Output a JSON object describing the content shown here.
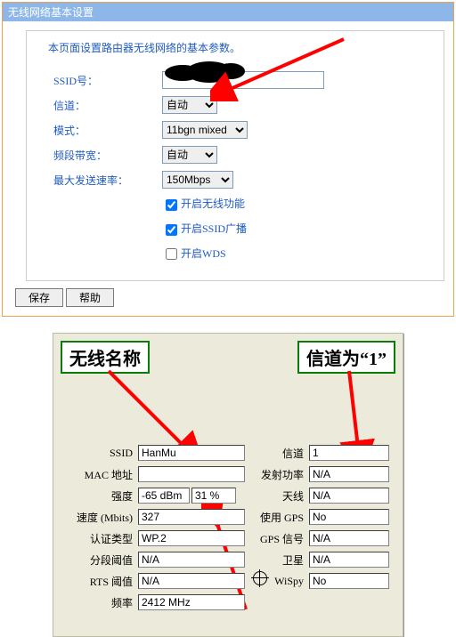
{
  "top_panel": {
    "title": "无线网络基本设置",
    "description": "本页面设置路由器无线网络的基本参数。",
    "rows": {
      "ssid_label": "SSID号：",
      "ssid_value": "",
      "channel_label": "信道：",
      "channel_value": "自动",
      "mode_label": "模式：",
      "mode_value": "11bgn mixed",
      "bandwidth_label": "频段带宽：",
      "bandwidth_value": "自动",
      "maxrate_label": "最大发送速率：",
      "maxrate_value": "150Mbps"
    },
    "checks": {
      "enable_wlan": "开启无线功能",
      "enable_broadcast": "开启SSID广播",
      "enable_wds": "开启WDS"
    },
    "buttons": {
      "save": "保存",
      "help": "帮助"
    }
  },
  "bottom_panel": {
    "callout_left": "无线名称",
    "callout_right": "信道为“1”",
    "fields": {
      "ssid_label": "SSID",
      "ssid": "HanMu",
      "channel_label": "信道",
      "channel": "1",
      "mac_label": "MAC 地址",
      "mac": "",
      "txpower_label": "发射功率",
      "txpower": "N/A",
      "strength_label": "强度",
      "strength_dbm": "-65 dBm",
      "strength_pct": "31 %",
      "antenna_label": "天线",
      "antenna": "N/A",
      "speed_label": "速度 (Mbits)",
      "speed": "327",
      "gps_label": "使用 GPS",
      "gps": "No",
      "auth_label": "认证类型",
      "auth": "WP.2",
      "gpssig_label": "GPS 信号",
      "gpssig": "N/A",
      "frag_label": "分段阈值",
      "frag": "N/A",
      "sat_label": "卫星",
      "sat": "N/A",
      "rts_label": "RTS 阈值",
      "rts": "N/A",
      "wispy_label": "WiSpy",
      "wispy": "No",
      "freq_label": "频率",
      "freq": "2412 MHz"
    }
  }
}
